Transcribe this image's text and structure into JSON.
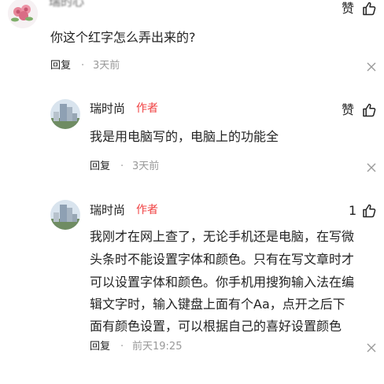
{
  "comment_top": {
    "author_partial": "瑞的心",
    "text": "你这个红字怎么弄出来的?",
    "reply_label": "回复",
    "sep": "·",
    "time": "3天前",
    "like_label": "赞"
  },
  "replies": [
    {
      "author": "瑞时尚",
      "author_tag": "作者",
      "text_lines": [
        "我是用电脑写的，电脑上的功能全"
      ],
      "reply_label": "回复",
      "sep": "·",
      "time": "3天前",
      "like_label": "赞"
    },
    {
      "author": "瑞时尚",
      "author_tag": "作者",
      "text_lines": [
        "我刚才在网上查了，无论手机还是电脑，在写微",
        "头条时不能设置字体和颜色。只有在写文章时才",
        "可以设置字体和颜色。你手机用搜狗输入法在编",
        "辑文字时，输入键盘上面有个Aa，点开之后下",
        "面有颜色设置，可以根据自己的喜好设置颜色"
      ],
      "reply_label": "回复",
      "sep": "·",
      "time": "前天19:25",
      "like_label": "1"
    }
  ],
  "colors": {
    "author_tag": "#f04142",
    "meta_time": "#999999"
  }
}
